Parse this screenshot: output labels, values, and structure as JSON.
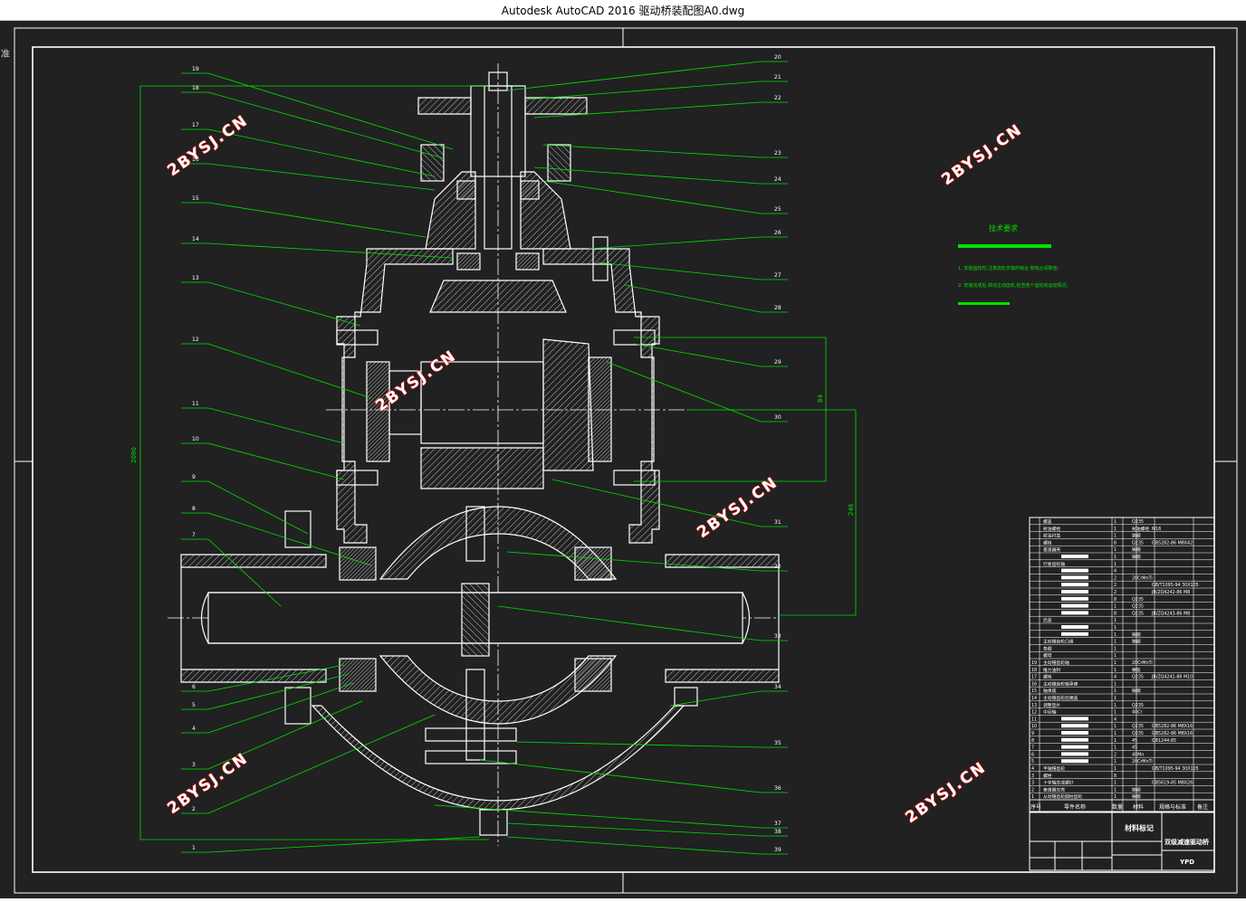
{
  "window": {
    "title": "Autodesk AutoCAD 2016     驱动桥装配图A0.dwg"
  },
  "corner_glyph": "准",
  "colors": {
    "background": "#212121",
    "frame": "#ffffff",
    "leader": "#00e000",
    "watermark": "#ffffff",
    "watermark_stroke": "#e01010"
  },
  "watermarks": [
    "2BYSJ.CN",
    "2BYSJ.CN",
    "2BYSJ.CN",
    "2BYSJ.CN",
    "2BYSJ.CN",
    "2BYSJ.CN"
  ],
  "tech_requirements": {
    "heading": "技术要求",
    "line1": "1. 安装齿轮时,注意齿轮安装的啮合 和啮合间隙值;",
    "line2": "2. 安装完成后,转动主动齿轮,检查各个齿轮的运动情况;"
  },
  "dimensions": {
    "overall_height": "2090",
    "d1": "84",
    "d2": "246"
  },
  "left_labels": [
    "19",
    "18",
    "17",
    "16",
    "15",
    "14",
    "13",
    "12",
    "11",
    "10",
    "9",
    "8",
    "7",
    "6",
    "5",
    "4",
    "3",
    "2",
    "1"
  ],
  "right_labels": [
    "20",
    "21",
    "22",
    "23",
    "24",
    "25",
    "26",
    "27",
    "28",
    "29",
    "30",
    "31",
    "32",
    "33",
    "34",
    "35",
    "36",
    "37",
    "38",
    "39"
  ],
  "bom": {
    "header": {
      "no": "序号",
      "name": "零件名称",
      "qty": "数量",
      "material": "材料",
      "std": "规格与标准",
      "note": "备注"
    },
    "rows": [
      {
        "no": "",
        "name": "螺盖",
        "qty": "1",
        "mat": "Q235",
        "std": ""
      },
      {
        "no": "",
        "name": "射油螺栓",
        "qty": "1",
        "mat": "射油螺栓",
        "std": "M16"
      },
      {
        "no": "",
        "name": "射油衬盖",
        "qty": "1",
        "mat": "铸钢",
        "std": ""
      },
      {
        "no": "",
        "name": "螺栓",
        "qty": "6",
        "mat": "Q235",
        "std": "GB5282-86 M8X42"
      },
      {
        "no": "",
        "name": "差速器壳",
        "qty": "1",
        "mat": "铸钢",
        "std": ""
      },
      {
        "no": "",
        "name": "",
        "qty": "1",
        "mat": "铸钢",
        "std": ""
      },
      {
        "no": "",
        "name": "行星齿轮轴",
        "qty": "1",
        "mat": "",
        "std": ""
      },
      {
        "no": "",
        "name": "",
        "qty": "4",
        "mat": "",
        "std": ""
      },
      {
        "no": "",
        "name": "",
        "qty": "2",
        "mat": "20CrMnTi",
        "std": ""
      },
      {
        "no": "",
        "name": "",
        "qty": "2",
        "mat": "",
        "std": "GB/T1095-94 30X105"
      },
      {
        "no": "",
        "name": "",
        "qty": "2",
        "mat": "",
        "std": "JB/ZQ4242-86 M8"
      },
      {
        "no": "",
        "name": "",
        "qty": "8",
        "mat": "Q235",
        "std": ""
      },
      {
        "no": "",
        "name": "",
        "qty": "1",
        "mat": "Q235",
        "std": ""
      },
      {
        "no": "",
        "name": "",
        "qty": "8",
        "mat": "Q235",
        "std": "JB/ZQ4243-86 M8"
      },
      {
        "no": "",
        "name": "后盖",
        "qty": "1",
        "mat": "",
        "std": ""
      },
      {
        "no": "",
        "name": "",
        "qty": "1",
        "mat": "",
        "std": ""
      },
      {
        "no": "",
        "name": "",
        "qty": "1",
        "mat": "铸钢",
        "std": ""
      },
      {
        "no": "",
        "name": "主动锥齿轮凸缘",
        "qty": "1",
        "mat": "铸钢",
        "std": ""
      },
      {
        "no": "",
        "name": "垫圈",
        "qty": "1",
        "mat": "",
        "std": ""
      },
      {
        "no": "",
        "name": "螺母",
        "qty": "1",
        "mat": "",
        "std": ""
      },
      {
        "no": "19",
        "name": "主动锥齿轮轴",
        "qty": "1",
        "mat": "20CrMnTi",
        "std": ""
      },
      {
        "no": "18",
        "name": "推力油封",
        "qty": "1",
        "mat": "橡胶",
        "std": ""
      },
      {
        "no": "17",
        "name": "螺栓",
        "qty": "4",
        "mat": "Q235",
        "std": "JB/ZQ4241-86 M10"
      },
      {
        "no": "16",
        "name": "主动锥齿轮轴承座",
        "qty": "1",
        "mat": "",
        "std": ""
      },
      {
        "no": "15",
        "name": "轴承座",
        "qty": "1",
        "mat": "铸钢",
        "std": ""
      },
      {
        "no": "14",
        "name": "主动锥齿轮后端盖",
        "qty": "1",
        "mat": "",
        "std": ""
      },
      {
        "no": "13",
        "name": "调整垫片",
        "qty": "1",
        "mat": "Q235",
        "std": ""
      },
      {
        "no": "12",
        "name": "中间轴",
        "qty": "1",
        "mat": "40Cr",
        "std": ""
      },
      {
        "no": "11",
        "name": "",
        "qty": "4",
        "mat": "",
        "std": ""
      },
      {
        "no": "10",
        "name": "",
        "qty": "1",
        "mat": "Q235",
        "std": "GB5282-86 M8X16"
      },
      {
        "no": "9",
        "name": "",
        "qty": "1",
        "mat": "Q235",
        "std": "GB5282-86 M8X16"
      },
      {
        "no": "8",
        "name": "",
        "qty": "1",
        "mat": "45",
        "std": "GB1244-85"
      },
      {
        "no": "7",
        "name": "",
        "qty": "1",
        "mat": "45",
        "std": ""
      },
      {
        "no": "6",
        "name": "",
        "qty": "2",
        "mat": "40Mn",
        "std": ""
      },
      {
        "no": "5",
        "name": "",
        "qty": "1",
        "mat": "20CrMnTi",
        "std": ""
      },
      {
        "no": "4",
        "name": "半轴锥齿轮",
        "qty": "1",
        "mat": "",
        "std": "GB/T1095-94 30X105"
      },
      {
        "no": "3",
        "name": "螺栓",
        "qty": "8",
        "mat": "",
        "std": ""
      },
      {
        "no": "3",
        "name": "十字轴总成螺钉",
        "qty": "1",
        "mat": "",
        "std": "GB5619-85 M8X26"
      },
      {
        "no": "2",
        "name": "差速器左壳",
        "qty": "1",
        "mat": "铸钢",
        "std": ""
      },
      {
        "no": "1",
        "name": "从动锥齿轮圆柱齿轮",
        "qty": "1",
        "mat": "铸钢",
        "std": ""
      }
    ]
  },
  "title_block": {
    "material_mark": "材料标记",
    "drawing_name": "双级减速驱动桥",
    "code": "YPD"
  }
}
